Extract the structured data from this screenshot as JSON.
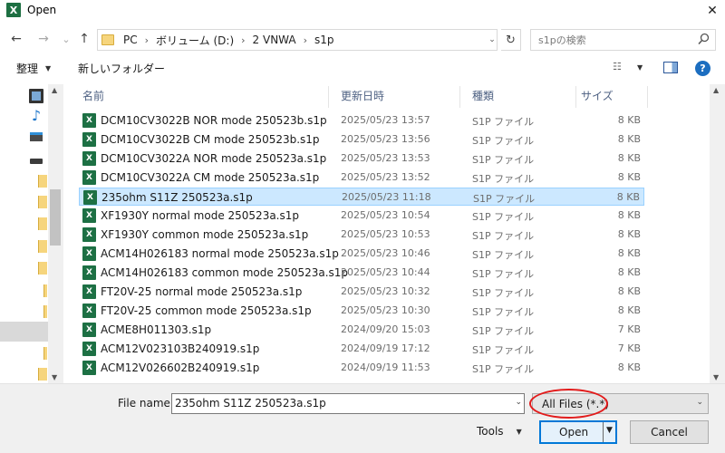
{
  "window": {
    "title": "Open",
    "app_icon_letter": "X",
    "close_glyph": "✕"
  },
  "nav": {
    "back_glyph": "←",
    "forward_glyph": "→",
    "recent_glyph": "⌄",
    "up_glyph": "↑"
  },
  "address": {
    "crumbs": [
      "PC",
      "ボリューム (D:)",
      "2 VNWA",
      "s1p"
    ],
    "separator": "›",
    "dropdown_glyph": "⌄",
    "refresh_glyph": "↻"
  },
  "search": {
    "placeholder": "s1pの検索",
    "icon": "search-icon"
  },
  "commands": {
    "organize_label": "整理",
    "new_folder_label": "新しいフォルダー",
    "caret": "▼",
    "view_glyph": "☷",
    "help_glyph": "?"
  },
  "columns": {
    "name": "名前",
    "date": "更新日時",
    "type": "種類",
    "size": "サイズ",
    "sort_glyph": "ˇ"
  },
  "files": [
    {
      "name": "DCM10CV3022B NOR mode 250523b.s1p",
      "date": "2025/05/23 13:57",
      "type": "S1P ファイル",
      "size": "8 KB"
    },
    {
      "name": "DCM10CV3022B CM mode 250523b.s1p",
      "date": "2025/05/23 13:56",
      "type": "S1P ファイル",
      "size": "8 KB"
    },
    {
      "name": "DCM10CV3022A NOR mode 250523a.s1p",
      "date": "2025/05/23 13:53",
      "type": "S1P ファイル",
      "size": "8 KB"
    },
    {
      "name": "DCM10CV3022A CM mode 250523a.s1p",
      "date": "2025/05/23 13:52",
      "type": "S1P ファイル",
      "size": "8 KB"
    },
    {
      "name": "235ohm S11Z 250523a.s1p",
      "date": "2025/05/23 11:18",
      "type": "S1P ファイル",
      "size": "8 KB",
      "selected": true
    },
    {
      "name": "XF1930Y normal mode 250523a.s1p",
      "date": "2025/05/23 10:54",
      "type": "S1P ファイル",
      "size": "8 KB"
    },
    {
      "name": "XF1930Y common mode 250523a.s1p",
      "date": "2025/05/23 10:53",
      "type": "S1P ファイル",
      "size": "8 KB"
    },
    {
      "name": "ACM14H026183 normal mode 250523a.s1p",
      "date": "2025/05/23 10:46",
      "type": "S1P ファイル",
      "size": "8 KB"
    },
    {
      "name": "ACM14H026183 common mode 250523a.s1p",
      "date": "2025/05/23 10:44",
      "type": "S1P ファイル",
      "size": "8 KB"
    },
    {
      "name": "FT20V-25 normal mode 250523a.s1p",
      "date": "2025/05/23 10:32",
      "type": "S1P ファイル",
      "size": "8 KB"
    },
    {
      "name": "FT20V-25 common mode 250523a.s1p",
      "date": "2025/05/23 10:30",
      "type": "S1P ファイル",
      "size": "8 KB"
    },
    {
      "name": "ACME8H011303.s1p",
      "date": "2024/09/20 15:03",
      "type": "S1P ファイル",
      "size": "7 KB"
    },
    {
      "name": "ACM12V023103B240919.s1p",
      "date": "2024/09/19 17:12",
      "type": "S1P ファイル",
      "size": "7 KB"
    },
    {
      "name": "ACM12V026602B240919.s1p",
      "date": "2024/09/19 11:53",
      "type": "S1P ファイル",
      "size": "8 KB"
    }
  ],
  "file_icon_letter": "X",
  "bottom": {
    "file_name_label": "File name:",
    "file_name_value": "235ohm S11Z 250523a.s1p",
    "file_type_value": "All Files (*.*)",
    "tools_label": "Tools",
    "open_label": "Open",
    "cancel_label": "Cancel",
    "dd_glyph": "⌄",
    "caret": "▼"
  },
  "colors": {
    "selection": "#cce8ff",
    "excel_green": "#1d7044",
    "highlight_ellipse": "#e21b1b",
    "primary_button_border": "#0078d7"
  }
}
